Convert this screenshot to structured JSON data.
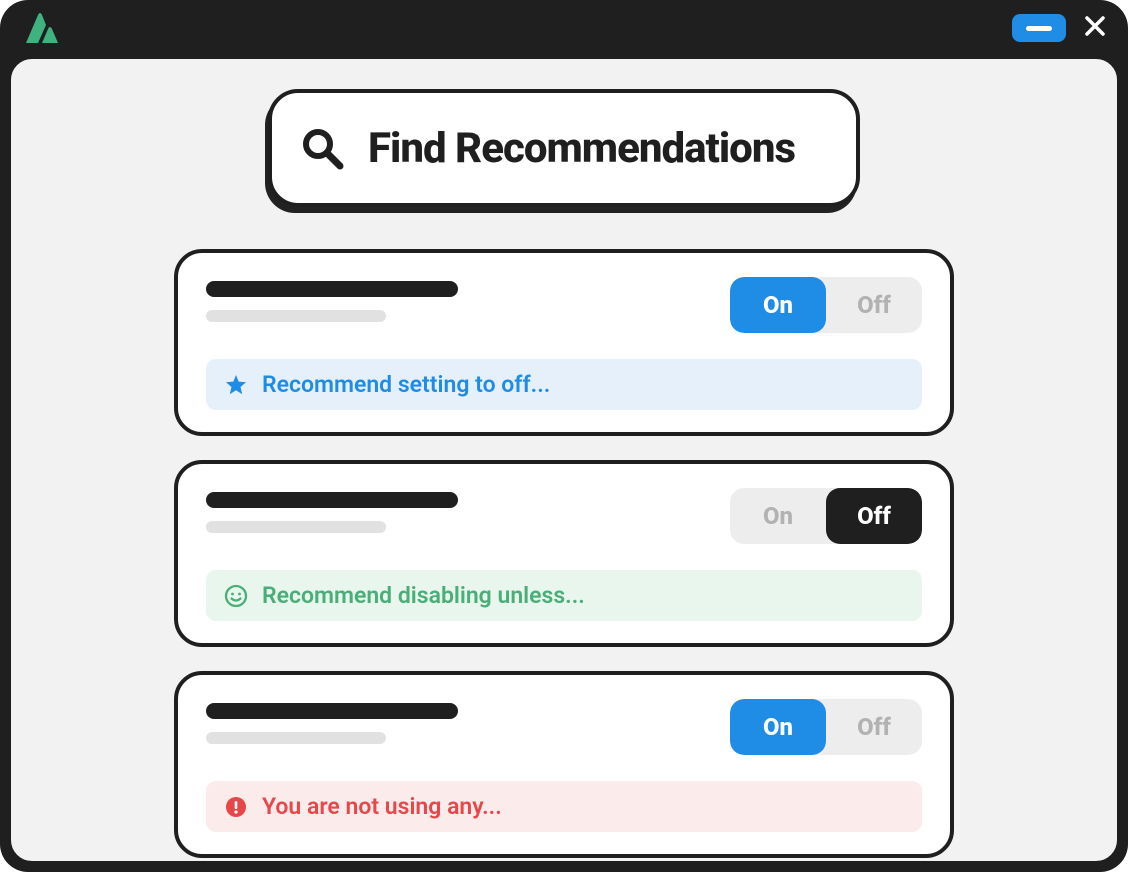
{
  "search": {
    "label": "Find Recommendations"
  },
  "toggle_labels": {
    "on": "On",
    "off": "Off"
  },
  "cards": [
    {
      "active": "on",
      "recommendation": {
        "variant": "blue",
        "icon": "star",
        "text": "Recommend setting to off..."
      }
    },
    {
      "active": "off",
      "recommendation": {
        "variant": "green",
        "icon": "smile",
        "text": "Recommend disabling unless..."
      }
    },
    {
      "active": "on",
      "recommendation": {
        "variant": "red",
        "icon": "alert",
        "text": "You are not using any..."
      }
    }
  ]
}
